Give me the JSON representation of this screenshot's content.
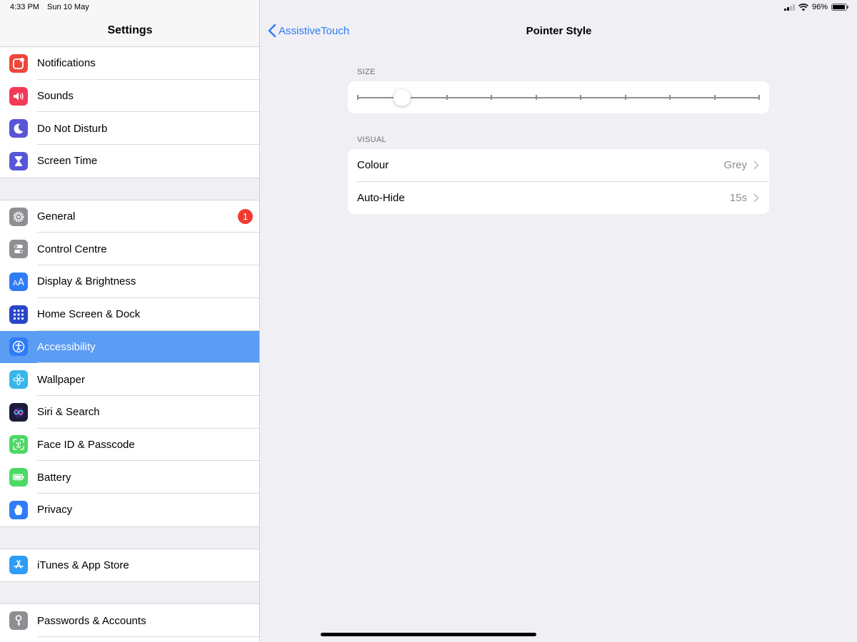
{
  "status_bar": {
    "time": "4:33 PM",
    "date": "Sun 10 May",
    "battery_percent": "96%",
    "battery_level": 0.96
  },
  "sidebar": {
    "title": "Settings",
    "groups": [
      [
        {
          "label": "Notifications",
          "icon": "notifications-icon",
          "color": "#f0453a"
        },
        {
          "label": "Sounds",
          "icon": "speaker-icon",
          "color": "#f23a57"
        },
        {
          "label": "Do Not Disturb",
          "icon": "moon-icon",
          "color": "#5856d6"
        },
        {
          "label": "Screen Time",
          "icon": "hourglass-icon",
          "color": "#5856d6"
        }
      ],
      [
        {
          "label": "General",
          "icon": "gear-icon",
          "color": "#8e8e93",
          "badge": "1"
        },
        {
          "label": "Control Centre",
          "icon": "toggles-icon",
          "color": "#8e8e93"
        },
        {
          "label": "Display & Brightness",
          "icon": "text-size-icon",
          "color": "#2f7cf6"
        },
        {
          "label": "Home Screen & Dock",
          "icon": "app-grid-icon",
          "color": "#2b46c9"
        },
        {
          "label": "Accessibility",
          "icon": "accessibility-icon",
          "color": "#2f7cf6",
          "selected": true
        },
        {
          "label": "Wallpaper",
          "icon": "flower-icon",
          "color": "#3ab5e8"
        },
        {
          "label": "Siri & Search",
          "icon": "siri-icon",
          "color": "#1c1c3a"
        },
        {
          "label": "Face ID & Passcode",
          "icon": "face-id-icon",
          "color": "#4cd964"
        },
        {
          "label": "Battery",
          "icon": "battery-icon",
          "color": "#4cd964"
        },
        {
          "label": "Privacy",
          "icon": "hand-icon",
          "color": "#2f7cf6"
        }
      ],
      [
        {
          "label": "iTunes & App Store",
          "icon": "app-store-icon",
          "color": "#2f9cf6"
        }
      ],
      [
        {
          "label": "Passwords & Accounts",
          "icon": "key-icon",
          "color": "#8e8e93"
        },
        {
          "label": "",
          "icon": "partial-icon",
          "color": "#c7c7cc"
        }
      ]
    ]
  },
  "detail": {
    "back_label": "AssistiveTouch",
    "title": "Pointer Style",
    "size_section": "SIZE",
    "size_slider": {
      "steps": 10,
      "value_index": 1
    },
    "visual_section": "VISUAL",
    "visual_rows": [
      {
        "label": "Colour",
        "value": "Grey"
      },
      {
        "label": "Auto-Hide",
        "value": "15s"
      }
    ]
  },
  "colors": {
    "accent": "#2f7cf6",
    "selection": "#5b9cf4",
    "badge": "#f03b30"
  }
}
